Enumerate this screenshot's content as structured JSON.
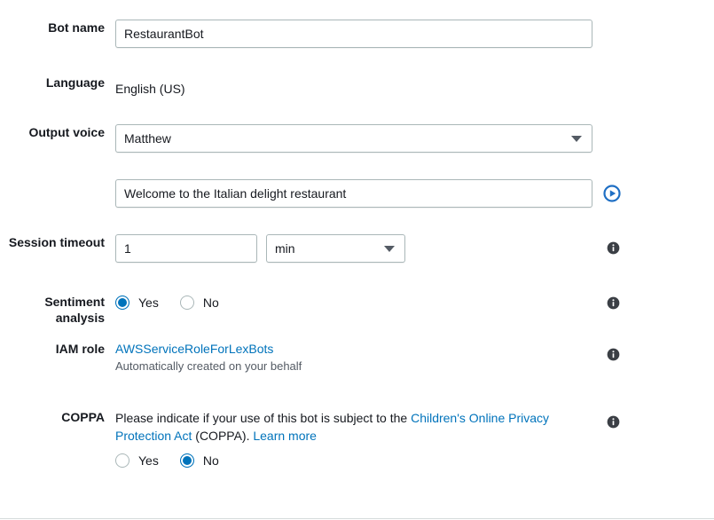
{
  "form": {
    "fields": {
      "bot_name": {
        "label": "Bot name",
        "value": "RestaurantBot",
        "placeholder": ""
      },
      "language": {
        "label": "Language",
        "value": "English (US)"
      },
      "output_voice": {
        "label": "Output voice",
        "value": "Matthew",
        "caret_icon": "chevron-down-icon"
      },
      "prompt": {
        "value": "Welcome to the Italian delight restaurant",
        "placeholder": "",
        "play_icon": "play-circle-icon"
      },
      "session_timeout": {
        "label": "Session timeout",
        "value": "1",
        "placeholder": "",
        "unit": "min",
        "caret_icon": "chevron-down-icon",
        "info_icon": "info-icon"
      },
      "sentiment_analysis": {
        "label": "Sentiment analysis",
        "options": [
          {
            "label": "Yes",
            "checked": true
          },
          {
            "label": "No",
            "checked": false
          }
        ],
        "info_icon": "info-icon"
      },
      "iam_role": {
        "label": "IAM role",
        "link_text": "AWSServiceRoleForLexBots",
        "description": "Automatically created on your behalf",
        "info_icon": "info-icon"
      },
      "coppa": {
        "label": "COPPA",
        "text_before": "Please indicate if your use of this bot is subject to the ",
        "link_text": "Children's Online Privacy Protection Act",
        "text_middle": " (COPPA). ",
        "learn_more": "Learn more",
        "options": [
          {
            "label": "Yes",
            "checked": false
          },
          {
            "label": "No",
            "checked": true
          }
        ],
        "info_icon": "info-icon"
      }
    }
  },
  "colors": {
    "link": "#0073bb",
    "accent": "#0073bb",
    "border": "#aab7b8",
    "text": "#16191f",
    "muted": "#545b64"
  }
}
